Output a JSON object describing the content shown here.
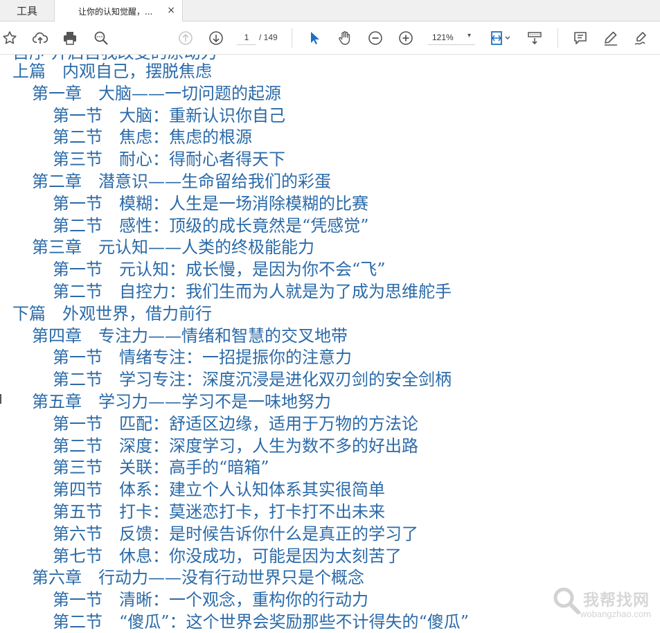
{
  "tabs": {
    "tools_label": "工具",
    "doc_label": "让你的认知觉醒，...",
    "close_glyph": "×"
  },
  "toolbar": {
    "page_current": "1",
    "page_total": "/ 149",
    "zoom": "121%",
    "zoom_caret": "▾",
    "icons": [
      "star-icon",
      "cloud-upload-icon",
      "print-icon",
      "search-icon",
      "page-up-icon",
      "page-down-icon",
      "select-arrow-icon",
      "hand-tool-icon",
      "zoom-out-icon",
      "zoom-in-icon",
      "fit-page-icon",
      "scroll-mode-icon",
      "comment-icon",
      "highlight-pen-icon",
      "sign-icon"
    ],
    "accent_color": "#1473e6"
  },
  "document": {
    "text_color": "#2a6aa8",
    "partial_top_line": "自序 开启自我改变的原动力",
    "toc": [
      {
        "level": 0,
        "text": "上篇　内观自己，摆脱焦虑"
      },
      {
        "level": 1,
        "text": "第一章　大脑——一切问题的起源"
      },
      {
        "level": 2,
        "text": "第一节　大脑：重新认识你自己"
      },
      {
        "level": 2,
        "text": "第二节　焦虑：焦虑的根源"
      },
      {
        "level": 2,
        "text": "第三节　耐心：得耐心者得天下"
      },
      {
        "level": 1,
        "text": "第二章　潜意识——生命留给我们的彩蛋"
      },
      {
        "level": 2,
        "text": "第一节　模糊：人生是一场消除模糊的比赛"
      },
      {
        "level": 2,
        "text": "第二节　感性：顶级的成长竟然是“凭感觉”"
      },
      {
        "level": 1,
        "text": "第三章　元认知——人类的终极能能力"
      },
      {
        "level": 2,
        "text": "第一节　元认知：成长慢，是因为你不会“飞”"
      },
      {
        "level": 2,
        "text": "第二节　自控力：我们生而为人就是为了成为思维舵手"
      },
      {
        "level": 0,
        "text": "下篇　外观世界，借力前行"
      },
      {
        "level": 1,
        "text": "第四章　专注力——情绪和智慧的交叉地带"
      },
      {
        "level": 2,
        "text": "第一节　情绪专注：一招提振你的注意力"
      },
      {
        "level": 2,
        "text": "第二节　学习专注：深度沉浸是进化双刃剑的安全剑柄"
      },
      {
        "level": 1,
        "text": "第五章　学习力——学习不是一味地努力"
      },
      {
        "level": 2,
        "text": "第一节　匹配：舒适区边缘，适用于万物的方法论"
      },
      {
        "level": 2,
        "text": "第二节　深度：深度学习，人生为数不多的好出路"
      },
      {
        "level": 2,
        "text": "第三节　关联：高手的“暗箱”"
      },
      {
        "level": 2,
        "text": "第四节　体系：建立个人认知体系其实很简单"
      },
      {
        "level": 2,
        "text": "第五节　打卡：莫迷恋打卡，打卡打不出未来"
      },
      {
        "level": 2,
        "text": "第六节　反馈：是时候告诉你什么是真正的学习了"
      },
      {
        "level": 2,
        "text": "第七节　休息：你没成功，可能是因为太刻苦了"
      },
      {
        "level": 1,
        "text": "第六章　行动力——没有行动世界只是个概念"
      },
      {
        "level": 2,
        "text": "第一节　清晰：一个观念，重构你的行动力"
      },
      {
        "level": 2,
        "text": "第二节　“傻瓜”：这个世界会奖励那些不计得失的“傻瓜”"
      }
    ]
  },
  "watermark": {
    "cn": "我帮找网",
    "en": "wobangzhao.com"
  }
}
